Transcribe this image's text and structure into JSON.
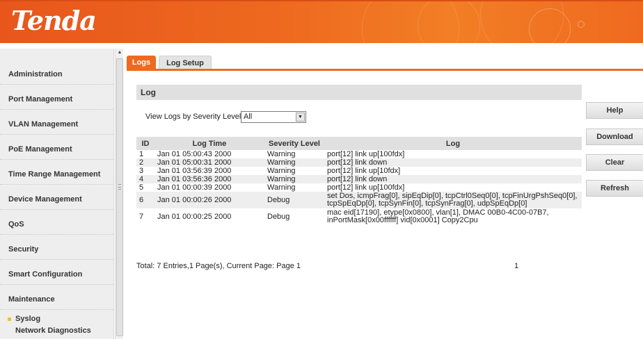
{
  "brand": {
    "logo_text": "Tenda",
    "accent_color": "#ef6a1f"
  },
  "sidebar": {
    "items": [
      {
        "label": "Administration"
      },
      {
        "label": "Port Management"
      },
      {
        "label": "VLAN Management"
      },
      {
        "label": "PoE Management"
      },
      {
        "label": "Time Range Management"
      },
      {
        "label": "Device Management"
      },
      {
        "label": "QoS"
      },
      {
        "label": "Security"
      },
      {
        "label": "Smart Configuration"
      },
      {
        "label": "Maintenance"
      }
    ],
    "sub_items": [
      {
        "label": "Syslog",
        "active": true
      },
      {
        "label": "Network Diagnostics",
        "active": false
      }
    ]
  },
  "tabs": [
    {
      "label": "Logs",
      "active": true
    },
    {
      "label": "Log Setup",
      "active": false
    }
  ],
  "main": {
    "section_title": "Log",
    "filter_label": "View Logs by Severity Level:",
    "filter_value": "All",
    "table": {
      "headers": [
        "ID",
        "Log Time",
        "Severity Level",
        "Log"
      ],
      "rows": [
        {
          "id": "1",
          "time": "Jan 01 05:00:43 2000",
          "severity": "Warning",
          "log": "port[12] link up[100fdx]"
        },
        {
          "id": "2",
          "time": "Jan 01 05:00:31 2000",
          "severity": "Warning",
          "log": "port[12] link down"
        },
        {
          "id": "3",
          "time": "Jan 01 03:56:39 2000",
          "severity": "Warning",
          "log": "port[12] link up[10fdx]"
        },
        {
          "id": "4",
          "time": "Jan 01 03:56:36 2000",
          "severity": "Warning",
          "log": "port[12] link down"
        },
        {
          "id": "5",
          "time": "Jan 01 00:00:39 2000",
          "severity": "Warning",
          "log": "port[12] link up[100fdx]"
        },
        {
          "id": "6",
          "time": "Jan 01 00:00:26 2000",
          "severity": "Debug",
          "log": "set Dos, icmpFrag[0], sipEqDip[0], tcpCtrl0Seq0[0], tcpFinUrgPshSeq0[0], tcpSpEqDp[0], tcpSynFin[0], tcpSynFrag[0], udpSpEqDp[0]"
        },
        {
          "id": "7",
          "time": "Jan 01 00:00:25 2000",
          "severity": "Debug",
          "log": "mac eid[17190], etype[0x0800], vlan[1], DMAC 00B0-4C00-07B7, inPortMask[0x00ffffff] vid[0x0001] Copy2Cpu"
        }
      ]
    },
    "footer": {
      "summary": "Total: 7 Entries,1 Page(s), Current Page: Page 1",
      "page_number": "1"
    }
  },
  "side_buttons": {
    "help": "Help",
    "download": "Download",
    "clear": "Clear",
    "refresh": "Refresh"
  }
}
